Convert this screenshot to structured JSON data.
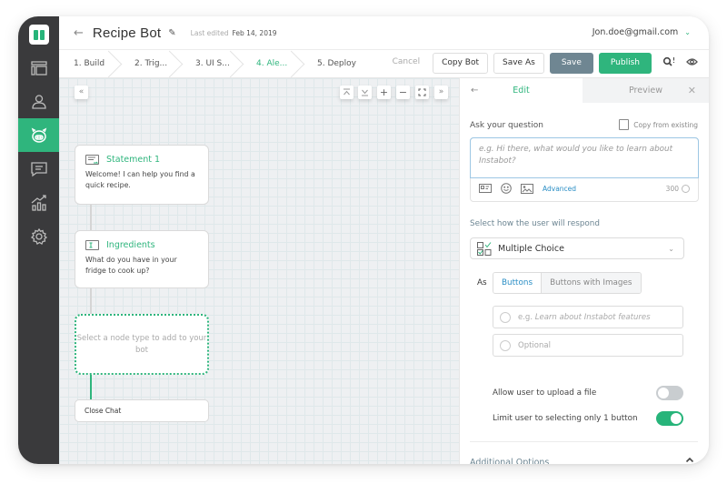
{
  "header": {
    "back_icon": "←",
    "title": "Recipe Bot",
    "edit_icon": "✎",
    "last_edited_label": "Last edited",
    "last_edited_date": "Feb 14, 2019",
    "user_email": "Jon.doe@gmail.com",
    "user_chevron": "⌄"
  },
  "steps": [
    {
      "label": "1. Build",
      "active": false
    },
    {
      "label": "2. Trig...",
      "active": false
    },
    {
      "label": "3. UI S...",
      "active": false
    },
    {
      "label": "4. Ale...",
      "active": true
    },
    {
      "label": "5. Deploy",
      "active": false
    }
  ],
  "actions": {
    "cancel": "Cancel",
    "copy_bot": "Copy Bot",
    "save_as": "Save As",
    "save": "Save",
    "publish": "Publish",
    "search_icon": "🔍",
    "preview_icon": "◉"
  },
  "sidebar": {
    "items": [
      {
        "icon": "layout-icon",
        "active": false
      },
      {
        "icon": "user-icon",
        "active": false
      },
      {
        "icon": "bot-icon",
        "active": true
      },
      {
        "icon": "chat-icon",
        "active": false
      },
      {
        "icon": "analytics-icon",
        "active": false
      },
      {
        "icon": "settings-icon",
        "active": false
      }
    ]
  },
  "canvas": {
    "tools": {
      "collapse_left": "«",
      "collapse_up": "⌅",
      "expand_down": "⌄",
      "zoom_in": "+",
      "zoom_out": "−",
      "fit": "⛶",
      "collapse_right": "»"
    },
    "nodes": [
      {
        "type": "statement",
        "name": "Statement 1",
        "text": "Welcome! I can help you find a quick recipe."
      },
      {
        "type": "input",
        "name": "Ingredients",
        "text": "What do you have in your fridge to cook up?"
      }
    ],
    "placeholder_text": "Select a node type to add to your bot",
    "end_node": "Close Chat"
  },
  "panel": {
    "back_icon": "←",
    "tab_edit": "Edit",
    "tab_preview": "Preview",
    "close_icon": "✕",
    "ask_label": "Ask your question",
    "copy_existing": "Copy from existing",
    "question_placeholder": "e.g. Hi there, what would you like to learn about Instabot?",
    "advanced": "Advanced",
    "char_count": "300",
    "respond_label": "Select how the user will respond",
    "response_type": "Multiple Choice",
    "as_label": "As",
    "as_options": [
      "Buttons",
      "Buttons with Images"
    ],
    "as_selected": "Buttons",
    "option1_prefix": "e.g.",
    "option1_placeholder": "Learn about Instabot features",
    "option2_placeholder": "Optional",
    "toggle_upload_label": "Allow user to upload a file",
    "toggle_upload_on": false,
    "toggle_limit_label": "Limit user to selecting only 1 button",
    "toggle_limit_on": true,
    "additional_options": "Additional Options",
    "additional_chevron": "⌃"
  },
  "colors": {
    "brand_green": "#2fb57d",
    "rail_dark": "#3a3a3c",
    "save_gray": "#6f8692",
    "link_blue": "#2a8ec5"
  }
}
